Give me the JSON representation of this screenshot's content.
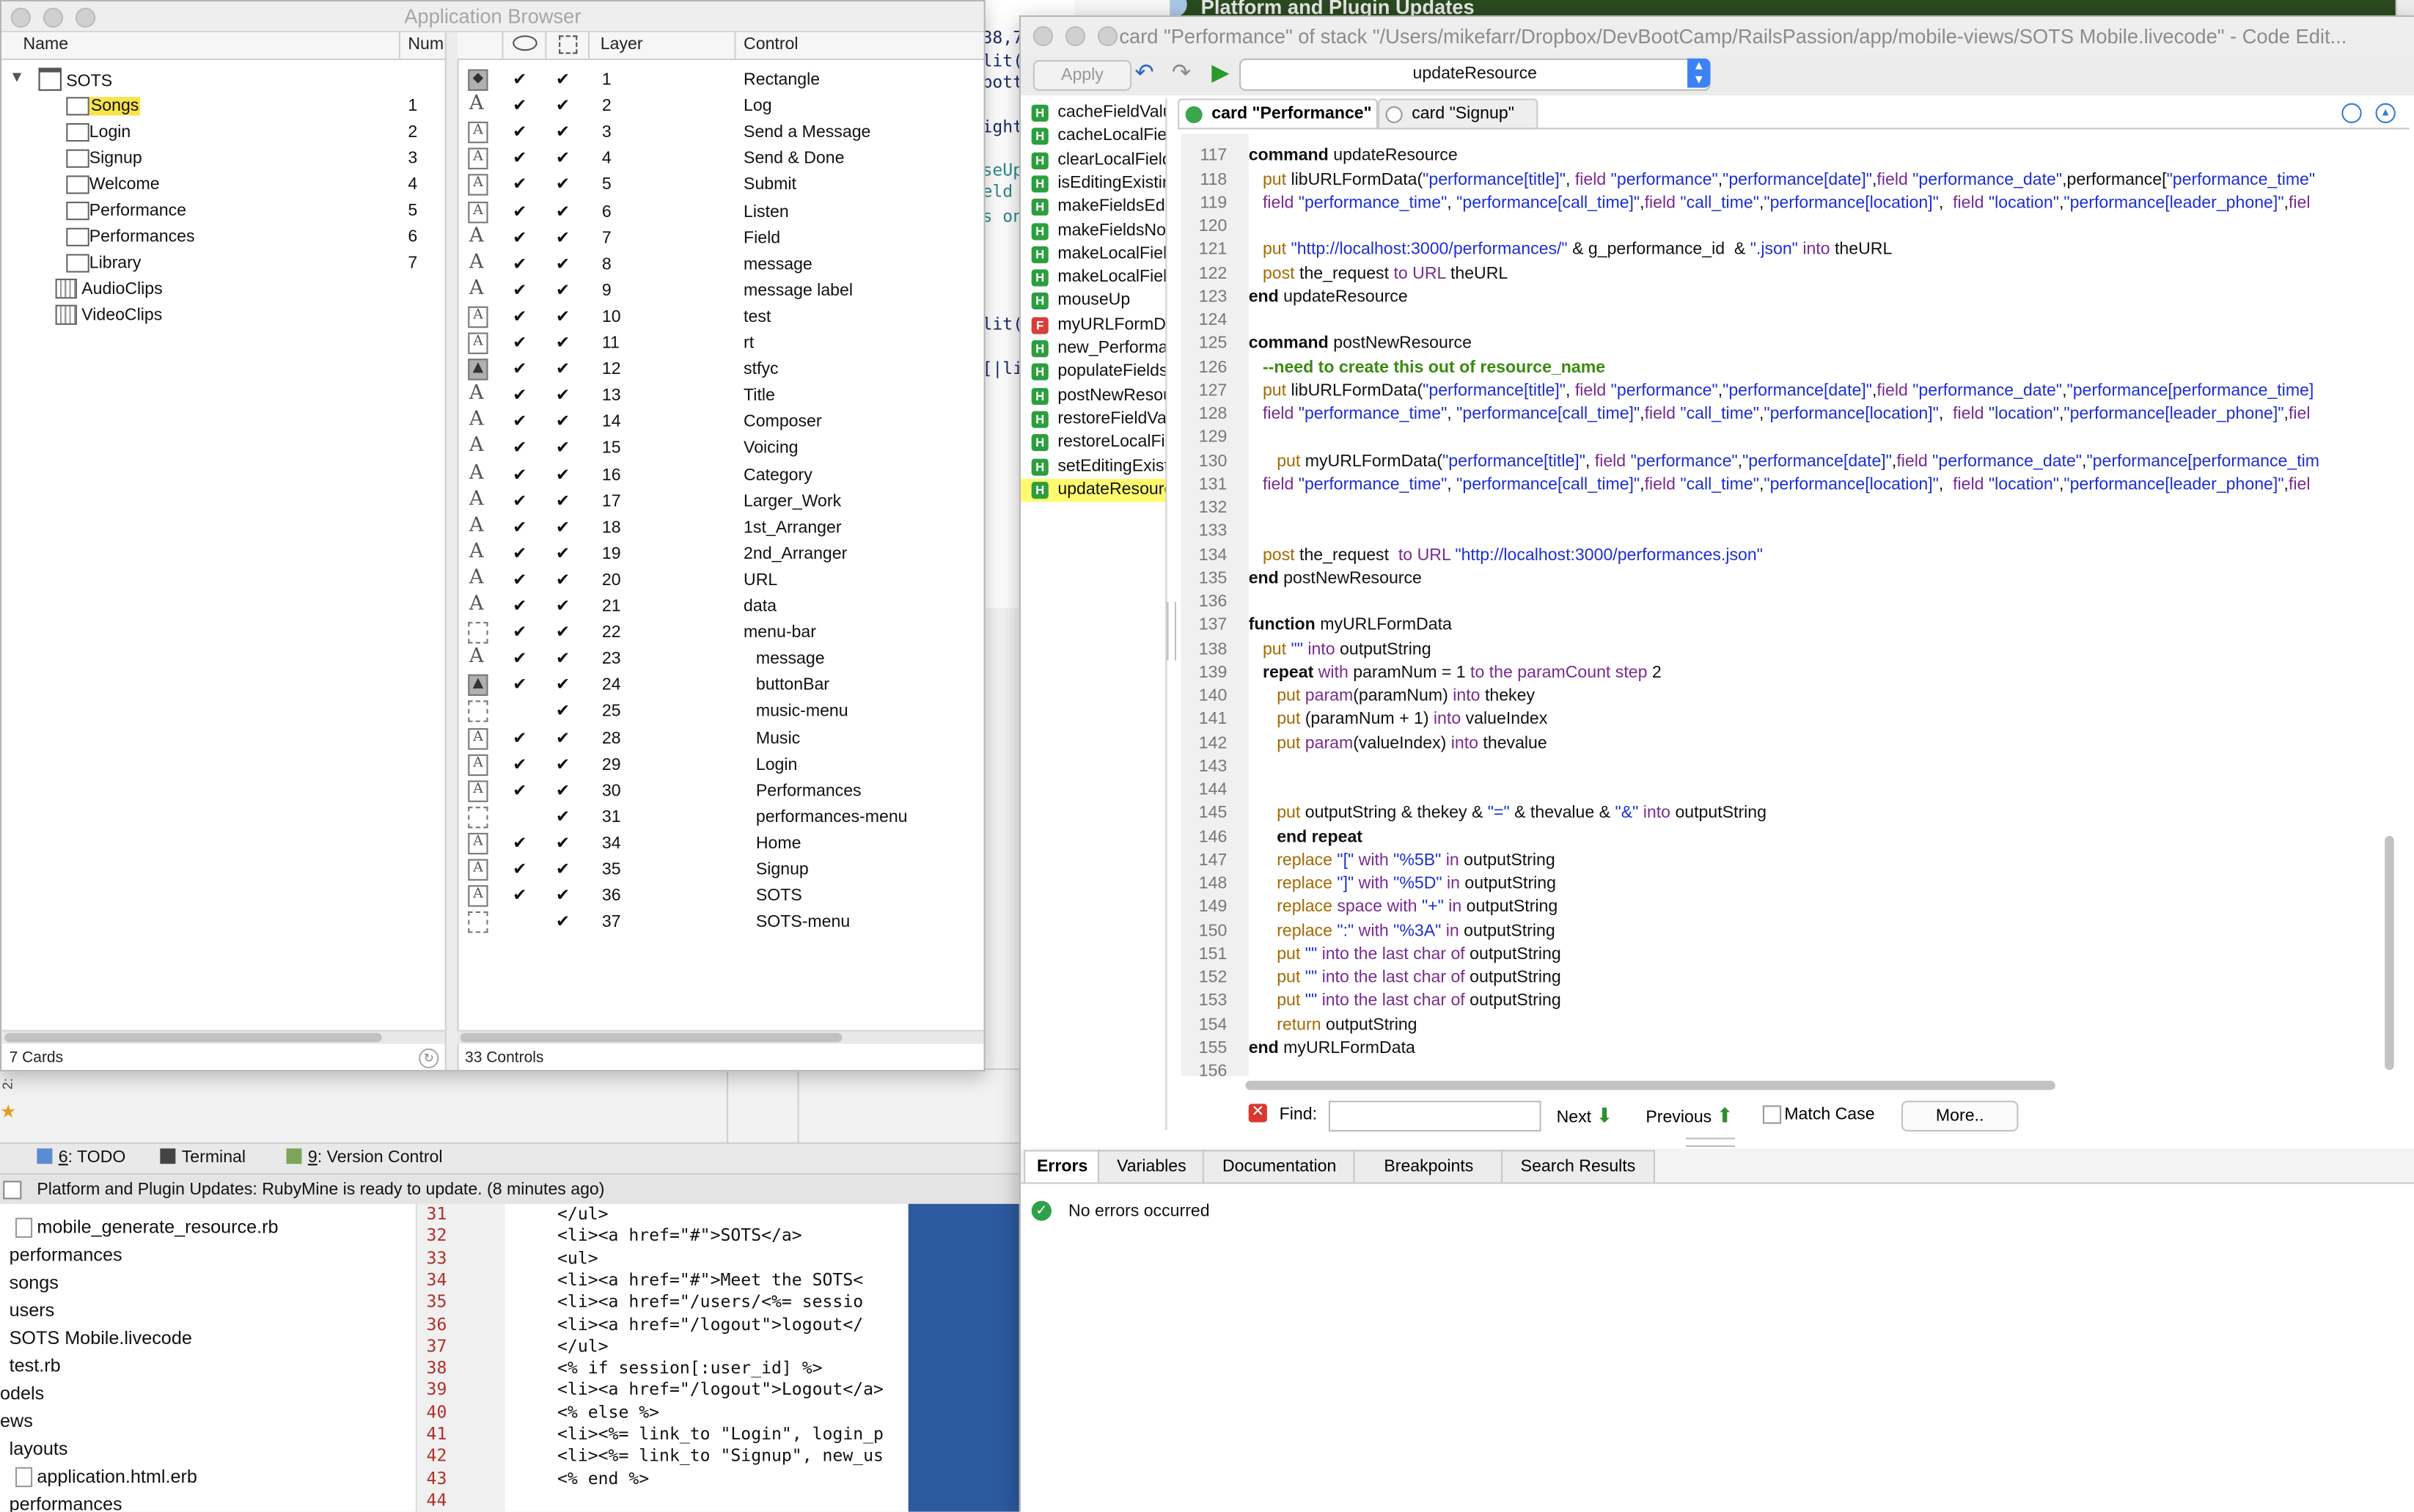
{
  "app_browser": {
    "title": "Application Browser",
    "cards_header": {
      "name": "Name",
      "num": "Num"
    },
    "controls_header": {
      "layer": "Layer",
      "control": "Control"
    },
    "stack": "SOTS",
    "cards": [
      {
        "name": "Songs",
        "num": "1"
      },
      {
        "name": "Login",
        "num": "2"
      },
      {
        "name": "Signup",
        "num": "3"
      },
      {
        "name": "Welcome",
        "num": "4"
      },
      {
        "name": "Performance",
        "num": "5"
      },
      {
        "name": "Performances",
        "num": "6"
      },
      {
        "name": "Library",
        "num": "7"
      }
    ],
    "folders": [
      {
        "name": "AudioClips"
      },
      {
        "name": "VideoClips"
      }
    ],
    "controls": [
      {
        "layer": "1",
        "name": "Rectangle",
        "type": "shape",
        "vis": true
      },
      {
        "layer": "2",
        "name": "Log",
        "type": "field",
        "vis": true
      },
      {
        "layer": "3",
        "name": "Send a Message",
        "type": "button",
        "vis": true
      },
      {
        "layer": "4",
        "name": "Send & Done",
        "type": "button",
        "vis": true
      },
      {
        "layer": "5",
        "name": "Submit",
        "type": "button",
        "vis": true
      },
      {
        "layer": "6",
        "name": "Listen",
        "type": "button",
        "vis": true
      },
      {
        "layer": "7",
        "name": "Field",
        "type": "field",
        "vis": true
      },
      {
        "layer": "8",
        "name": "message",
        "type": "field",
        "vis": true
      },
      {
        "layer": "9",
        "name": "message label",
        "type": "field",
        "vis": true
      },
      {
        "layer": "10",
        "name": "test",
        "type": "button",
        "vis": true
      },
      {
        "layer": "11",
        "name": "rt",
        "type": "button",
        "vis": true
      },
      {
        "layer": "12",
        "name": "stfyc",
        "type": "image",
        "vis": true
      },
      {
        "layer": "13",
        "name": "Title",
        "type": "field",
        "vis": true
      },
      {
        "layer": "14",
        "name": "Composer",
        "type": "field",
        "vis": true
      },
      {
        "layer": "15",
        "name": "Voicing",
        "type": "field",
        "vis": true
      },
      {
        "layer": "16",
        "name": "Category",
        "type": "field",
        "vis": true
      },
      {
        "layer": "17",
        "name": "Larger_Work",
        "type": "field",
        "vis": true
      },
      {
        "layer": "18",
        "name": "1st_Arranger",
        "type": "field",
        "vis": true
      },
      {
        "layer": "19",
        "name": "2nd_Arranger",
        "type": "field",
        "vis": true
      },
      {
        "layer": "20",
        "name": "URL",
        "type": "field",
        "vis": true
      },
      {
        "layer": "21",
        "name": "data",
        "type": "field",
        "vis": true
      },
      {
        "layer": "22",
        "name": "menu-bar",
        "type": "group",
        "vis": true
      },
      {
        "layer": "23",
        "name": "message",
        "type": "field",
        "vis": true,
        "indent": true
      },
      {
        "layer": "24",
        "name": "buttonBar",
        "type": "image",
        "vis": true,
        "indent": true
      },
      {
        "layer": "25",
        "name": "music-menu",
        "type": "group",
        "vis": false,
        "indent": true
      },
      {
        "layer": "28",
        "name": "Music",
        "type": "button",
        "vis": true,
        "indent": true
      },
      {
        "layer": "29",
        "name": "Login",
        "type": "button",
        "vis": true,
        "indent": true
      },
      {
        "layer": "30",
        "name": "Performances",
        "type": "button",
        "vis": true,
        "indent": true
      },
      {
        "layer": "31",
        "name": "performances-menu",
        "type": "group",
        "vis": false,
        "indent": true
      },
      {
        "layer": "34",
        "name": "Home",
        "type": "button",
        "vis": true,
        "indent": true
      },
      {
        "layer": "35",
        "name": "Signup",
        "type": "button",
        "vis": true,
        "indent": true
      },
      {
        "layer": "36",
        "name": "SOTS",
        "type": "button",
        "vis": true,
        "indent": true
      },
      {
        "layer": "37",
        "name": "SOTS-menu",
        "type": "group",
        "vis": false,
        "indent": true
      }
    ],
    "cards_count": "7 Cards",
    "controls_count": "33 Controls"
  },
  "code_editor": {
    "title": "card \"Performance\" of stack \"/Users/mikefarr/Dropbox/DevBootCamp/RailsPassion/app/mobile-views/SOTS Mobile.livecode\" - Code Edit...",
    "apply": "Apply",
    "handler_select": "updateResource",
    "handlers": [
      {
        "name": "cacheFieldValues",
        "kind": "H"
      },
      {
        "name": "cacheLocalFields",
        "kind": "H"
      },
      {
        "name": "clearLocalFields",
        "kind": "H"
      },
      {
        "name": "isEditingExisting",
        "kind": "H"
      },
      {
        "name": "makeFieldsEditable",
        "kind": "H"
      },
      {
        "name": "makeFieldsNonEditable",
        "kind": "H"
      },
      {
        "name": "makeLocalFields",
        "kind": "H"
      },
      {
        "name": "makeLocalFieldsVisible",
        "kind": "H"
      },
      {
        "name": "mouseUp",
        "kind": "H"
      },
      {
        "name": "myURLFormData",
        "kind": "F"
      },
      {
        "name": "new_Performance",
        "kind": "H"
      },
      {
        "name": "populateFields",
        "kind": "H"
      },
      {
        "name": "postNewResource",
        "kind": "H"
      },
      {
        "name": "restoreFieldValues",
        "kind": "H"
      },
      {
        "name": "restoreLocalFields",
        "kind": "H"
      },
      {
        "name": "setEditingExisting",
        "kind": "H"
      },
      {
        "name": "updateResource",
        "kind": "H",
        "selected": true
      }
    ],
    "tabs": [
      {
        "label": "card \"Performance\""
      },
      {
        "label": "card \"Signup\""
      }
    ],
    "code_lines": [
      {
        "n": "117",
        "html": "<span class='k'>command</span> updateResource"
      },
      {
        "n": "118",
        "html": "   <span class='g'>put</span> libURLFormData(<span class='s'>\"performance[title]\"</span>, <span class='p'>field</span> <span class='s'>\"performance\"</span>,<span class='s'>\"performance[date]\"</span>,<span class='p'>field</span> <span class='s'>\"performance_date\"</span>,performance[<span class='s'>\"performance_time\"</span>"
      },
      {
        "n": "119",
        "html": "   <span class='p'>field</span> <span class='s'>\"performance_time\"</span>, <span class='s'>\"performance[call_time]\"</span>,<span class='p'>field</span> <span class='s'>\"call_time\"</span>,<span class='s'>\"performance[location]\"</span>,  <span class='p'>field</span> <span class='s'>\"location\"</span>,<span class='s'>\"performance[leader_phone]\"</span>,<span class='p'>fiel</span>"
      },
      {
        "n": "120",
        "html": ""
      },
      {
        "n": "121",
        "html": "   <span class='g'>put</span> <span class='s'>\"http://localhost:3000/performances/\"</span> &amp; g_performance_id  &amp; <span class='s'>\".json\"</span> <span class='p'>into</span> theURL"
      },
      {
        "n": "122",
        "html": "   <span class='g'>post</span> the_request <span class='p'>to</span> <span class='p'>URL</span> theURL"
      },
      {
        "n": "123",
        "html": "<span class='k'>end</span> updateResource"
      },
      {
        "n": "124",
        "html": ""
      },
      {
        "n": "125",
        "html": "<span class='k'>command</span> postNewResource"
      },
      {
        "n": "126",
        "html": "   <span class='c'>--need to create this out of resource_name</span>"
      },
      {
        "n": "127",
        "html": "   <span class='g'>put</span> libURLFormData(<span class='s'>\"performance[title]\"</span>, <span class='p'>field</span> <span class='s'>\"performance\"</span>,<span class='s'>\"performance[date]\"</span>,<span class='p'>field</span> <span class='s'>\"performance_date\"</span>,<span class='s'>\"performance[performance_time]</span>"
      },
      {
        "n": "128",
        "html": "   <span class='p'>field</span> <span class='s'>\"performance_time\"</span>, <span class='s'>\"performance[call_time]\"</span>,<span class='p'>field</span> <span class='s'>\"call_time\"</span>,<span class='s'>\"performance[location]\"</span>,  <span class='p'>field</span> <span class='s'>\"location\"</span>,<span class='s'>\"performance[leader_phone]\"</span>,<span class='p'>fiel</span>"
      },
      {
        "n": "129",
        "html": ""
      },
      {
        "n": "130",
        "html": "      <span class='g'>put</span> myURLFormData(<span class='s'>\"performance[title]\"</span>, <span class='p'>field</span> <span class='s'>\"performance\"</span>,<span class='s'>\"performance[date]\"</span>,<span class='p'>field</span> <span class='s'>\"performance_date\"</span>,<span class='s'>\"performance[performance_tim</span>"
      },
      {
        "n": "131",
        "html": "   <span class='p'>field</span> <span class='s'>\"performance_time\"</span>, <span class='s'>\"performance[call_time]\"</span>,<span class='p'>field</span> <span class='s'>\"call_time\"</span>,<span class='s'>\"performance[location]\"</span>,  <span class='p'>field</span> <span class='s'>\"location\"</span>,<span class='s'>\"performance[leader_phone]\"</span>,<span class='p'>fiel</span>"
      },
      {
        "n": "132",
        "html": ""
      },
      {
        "n": "133",
        "html": ""
      },
      {
        "n": "134",
        "html": "   <span class='g'>post</span> the_request  <span class='p'>to</span> <span class='p'>URL</span> <span class='s'>\"http://localhost:3000/performances.json\"</span>"
      },
      {
        "n": "135",
        "html": "<span class='k'>end</span> postNewResource"
      },
      {
        "n": "136",
        "html": ""
      },
      {
        "n": "137",
        "html": "<span class='k'>function</span> myURLFormData"
      },
      {
        "n": "138",
        "html": "   <span class='g'>put</span> <span class='s'>\"\"</span> <span class='p'>into</span> outputString"
      },
      {
        "n": "139",
        "html": "   <span class='k'>repeat</span> <span class='p'>with</span> paramNum = 1 <span class='p'>to</span> <span class='p'>the paramCount</span> <span class='p'>step</span> 2"
      },
      {
        "n": "140",
        "html": "      <span class='g'>put</span> <span class='p'>param</span>(paramNum) <span class='p'>into</span> thekey"
      },
      {
        "n": "141",
        "html": "      <span class='g'>put</span> (paramNum + 1) <span class='p'>into</span> valueIndex"
      },
      {
        "n": "142",
        "html": "      <span class='g'>put</span> <span class='p'>param</span>(valueIndex) <span class='p'>into</span> thevalue"
      },
      {
        "n": "143",
        "html": ""
      },
      {
        "n": "144",
        "html": ""
      },
      {
        "n": "145",
        "html": "      <span class='g'>put</span> outputString &amp; thekey &amp; <span class='s'>\"=\"</span> &amp; thevalue &amp; <span class='s'>\"&amp;\"</span> <span class='p'>into</span> outputString"
      },
      {
        "n": "146",
        "html": "      <span class='k'>end repeat</span>"
      },
      {
        "n": "147",
        "html": "      <span class='g'>replace</span> <span class='s'>\"[\"</span> <span class='p'>with</span> <span class='s'>\"%5B\"</span> <span class='p'>in</span> outputString"
      },
      {
        "n": "148",
        "html": "      <span class='g'>replace</span> <span class='s'>\"]\"</span> <span class='p'>with</span> <span class='s'>\"%5D\"</span> <span class='p'>in</span> outputString"
      },
      {
        "n": "149",
        "html": "      <span class='g'>replace</span> <span class='p'>space</span> <span class='p'>with</span> <span class='s'>\"+\"</span> <span class='p'>in</span> outputString"
      },
      {
        "n": "150",
        "html": "      <span class='g'>replace</span> <span class='s'>\":\"</span> <span class='p'>with</span> <span class='s'>\"%3A\"</span> <span class='p'>in</span> outputString"
      },
      {
        "n": "151",
        "html": "      <span class='g'>put</span> <span class='s'>\"\"</span> <span class='p'>into the last char of</span> outputString"
      },
      {
        "n": "152",
        "html": "      <span class='g'>put</span> <span class='s'>\"\"</span> <span class='p'>into the last char of</span> outputString"
      },
      {
        "n": "153",
        "html": "      <span class='g'>put</span> <span class='s'>\"\"</span> <span class='p'>into the last char of</span> outputString"
      },
      {
        "n": "154",
        "html": "      <span class='g'>return</span> outputString"
      },
      {
        "n": "155",
        "html": "<span class='k'>end</span> myURLFormData"
      },
      {
        "n": "156",
        "html": ""
      }
    ],
    "find": {
      "label": "Find:",
      "next": "Next",
      "previous": "Previous",
      "match_case": "Match Case",
      "more": "More.."
    },
    "bottom_tabs": [
      "Errors",
      "Variables",
      "Documentation",
      "Breakpoints",
      "Search Results"
    ],
    "errors_message": "No errors occurred"
  },
  "ide": {
    "update_banner": "Platform and Plugin Updates",
    "toolwindows": [
      {
        "num": "6",
        "label": ": TODO"
      },
      {
        "num": "",
        "label": "Terminal"
      },
      {
        "num": "9",
        "label": ": Version Control"
      }
    ],
    "notification": "Platform and Plugin Updates: RubyMine is ready to update. (8 minutes ago)",
    "project_files": [
      "mobile_generate_resource.rb",
      "performances",
      "songs",
      "users",
      "SOTS Mobile.livecode",
      "test.rb",
      "odels",
      "ews",
      "layouts",
      "application.html.erb",
      "performances"
    ],
    "line_numbers": [
      "31",
      "32",
      "33",
      "34",
      "35",
      "36",
      "37",
      "38",
      "39",
      "40",
      "41",
      "42",
      "43",
      "44"
    ],
    "code": [
      "  </ul>",
      "  <li><a href=\"#\">SOTS</a>",
      "    <ul>",
      "      <li><a href=\"#\">Meet the SOTS<",
      "      <li><a href=\"/users/<%= sessio",
      "      <li><a href=\"/logout\">logout</",
      "    </ul>",
      "    <% if session[:user_id] %>",
      "    <li><a href=\"/logout\">Logout</a>",
      "<% else %>",
      "  <li><%= link_to \"Login\", login_p",
      "  <li><%= link_to \"Signup\", new_us",
      "<% end %>",
      ""
    ],
    "behind_fragments": [
      "38,7",
      "lit(\"",
      "bott",
      "ight",
      "seUp",
      "eld",
      "s on",
      "lit(",
      "[|li"
    ],
    "right_fragments": [
      "le",
      "le",
      "le",
      "Ma",
      "le"
    ],
    "side_labels": {
      "right_bh": "b",
      "right_sio": "sio",
      "right_ee": "eF",
      "left_marker": "2:"
    }
  }
}
